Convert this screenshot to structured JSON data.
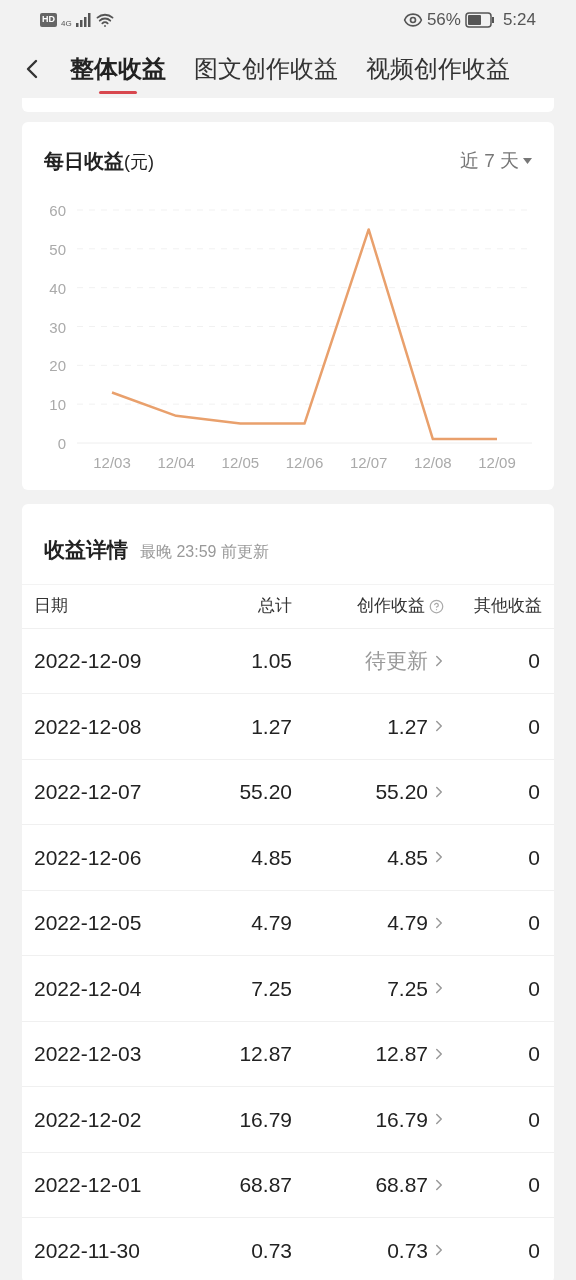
{
  "status_bar": {
    "hd": "HD",
    "network": "4G",
    "battery": "56%",
    "time": "5:24"
  },
  "tabs": [
    {
      "label": "整体收益",
      "selected": true
    },
    {
      "label": "图文创作收益",
      "selected": false
    },
    {
      "label": "视频创作收益",
      "selected": false
    }
  ],
  "chart_card": {
    "title": "每日收益",
    "unit": "(元)",
    "range": "近 7 天",
    "chart_data": {
      "type": "line",
      "categories": [
        "12/03",
        "12/04",
        "12/05",
        "12/06",
        "12/07",
        "12/08",
        "12/09"
      ],
      "yticks": [
        0,
        10,
        20,
        30,
        40,
        50,
        60
      ],
      "ylim": [
        0,
        60
      ],
      "grid": true,
      "series": [
        {
          "color": "#e9a06c",
          "values": [
            13,
            7,
            5,
            5,
            55,
            1,
            1
          ]
        }
      ]
    }
  },
  "details": {
    "title": "收益详情",
    "note": "最晚 23:59 前更新",
    "columns": [
      "日期",
      "总计",
      "创作收益",
      "其他收益"
    ],
    "rows": [
      {
        "date": "2022-12-09",
        "total": "1.05",
        "creation": "待更新",
        "pending": true,
        "other": "0"
      },
      {
        "date": "2022-12-08",
        "total": "1.27",
        "creation": "1.27",
        "pending": false,
        "other": "0"
      },
      {
        "date": "2022-12-07",
        "total": "55.20",
        "creation": "55.20",
        "pending": false,
        "other": "0"
      },
      {
        "date": "2022-12-06",
        "total": "4.85",
        "creation": "4.85",
        "pending": false,
        "other": "0"
      },
      {
        "date": "2022-12-05",
        "total": "4.79",
        "creation": "4.79",
        "pending": false,
        "other": "0"
      },
      {
        "date": "2022-12-04",
        "total": "7.25",
        "creation": "7.25",
        "pending": false,
        "other": "0"
      },
      {
        "date": "2022-12-03",
        "total": "12.87",
        "creation": "12.87",
        "pending": false,
        "other": "0"
      },
      {
        "date": "2022-12-02",
        "total": "16.79",
        "creation": "16.79",
        "pending": false,
        "other": "0"
      },
      {
        "date": "2022-12-01",
        "total": "68.87",
        "creation": "68.87",
        "pending": false,
        "other": "0"
      },
      {
        "date": "2022-11-30",
        "total": "0.73",
        "creation": "0.73",
        "pending": false,
        "other": "0"
      }
    ]
  }
}
